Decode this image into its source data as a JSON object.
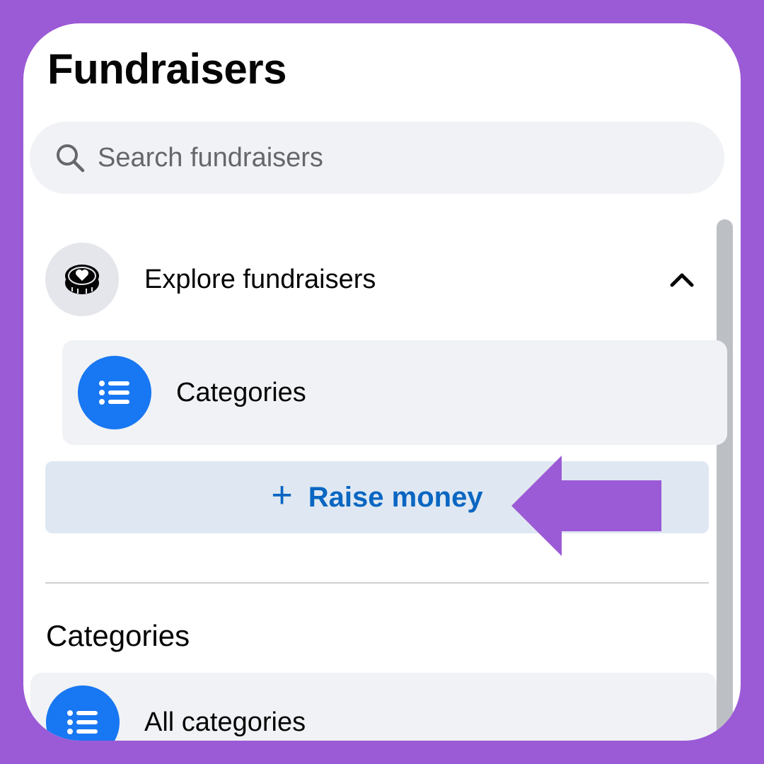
{
  "header": {
    "title": "Fundraisers"
  },
  "search": {
    "placeholder": "Search fundraisers",
    "icon": "search-icon"
  },
  "nav": {
    "explore": {
      "label": "Explore fundraisers",
      "icon": "heart-coin-icon",
      "expanded": true
    },
    "subitems": [
      {
        "label": "Categories",
        "icon": "list-icon"
      }
    ]
  },
  "actions": {
    "raise_money": "Raise money",
    "raise_money_icon": "plus-icon"
  },
  "categories_section": {
    "heading": "Categories",
    "items": [
      {
        "label": "All categories",
        "icon": "list-icon"
      }
    ]
  },
  "colors": {
    "background": "#9b5ad6",
    "accent": "#1877f2",
    "raise_button_bg": "#dfe8f2",
    "raise_button_text": "#0a66c2",
    "annotation_arrow": "#9b5ad6"
  }
}
